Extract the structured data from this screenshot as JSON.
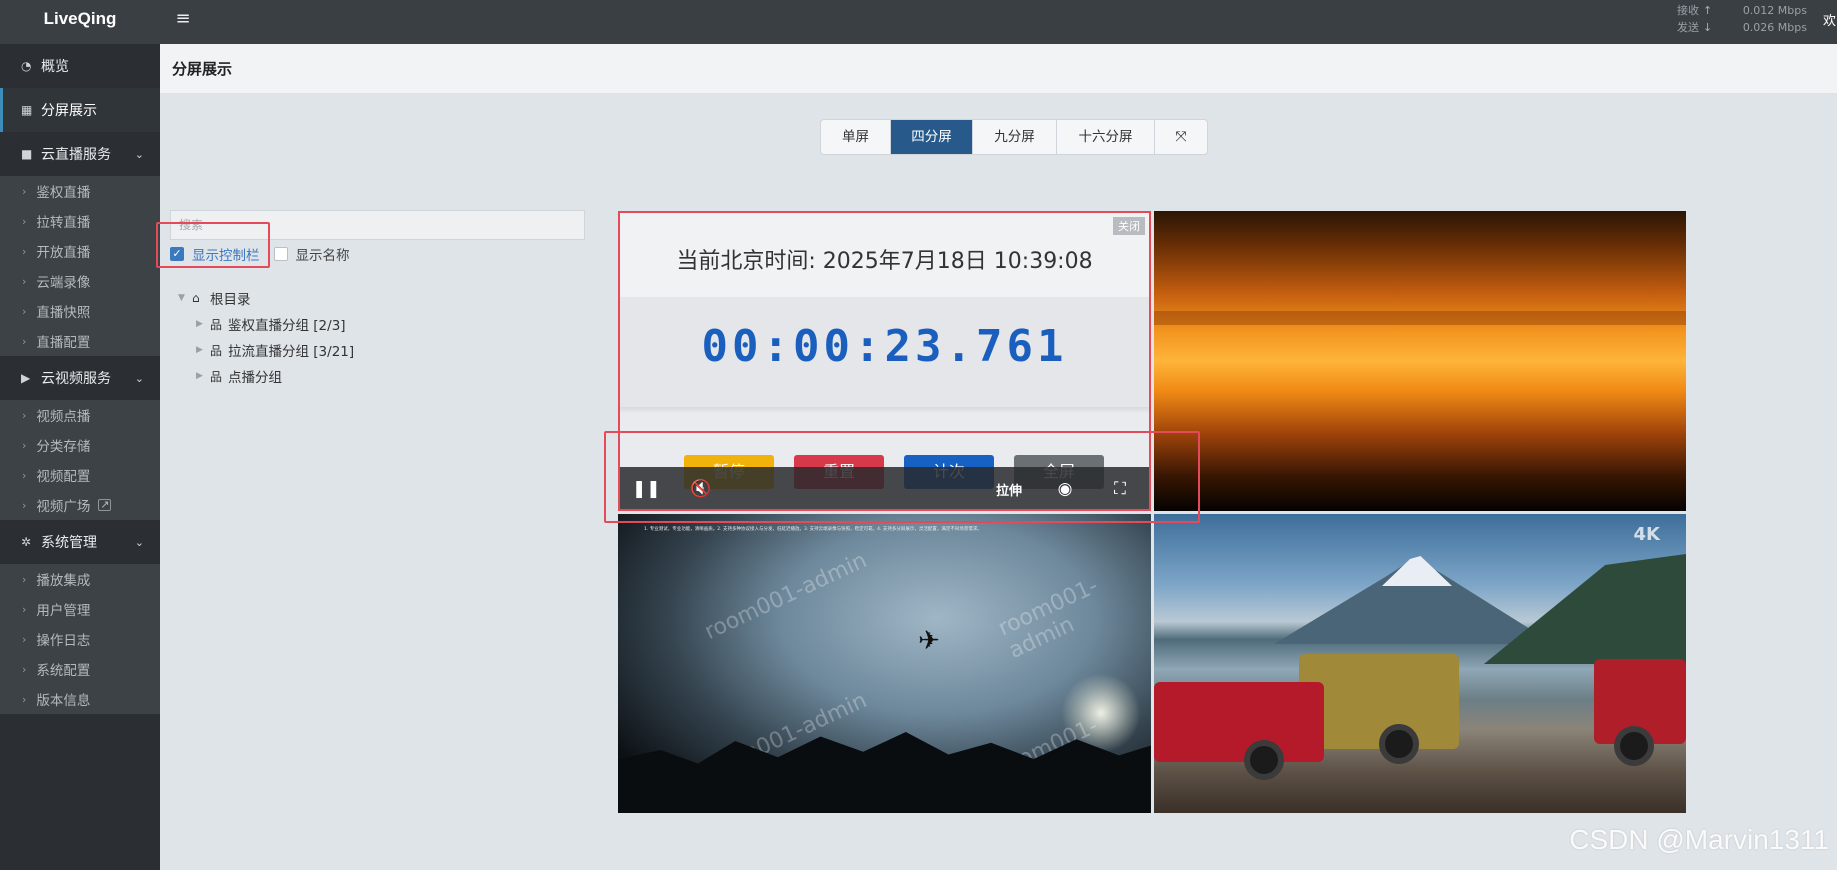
{
  "app": {
    "logo": "LiveQing"
  },
  "net": {
    "recv_label": "接收",
    "recv_value": "0.012 Mbps",
    "send_label": "发送",
    "send_value": "0.026 Mbps"
  },
  "topright_text": "欢",
  "sidebar": {
    "top_items": [
      {
        "label": "概览"
      },
      {
        "label": "分屏展示"
      }
    ],
    "groups": [
      {
        "label": "云直播服务",
        "items": [
          "鉴权直播",
          "拉转直播",
          "开放直播",
          "云端录像",
          "直播快照",
          "直播配置"
        ]
      },
      {
        "label": "云视频服务",
        "items": [
          "视频点播",
          "分类存储",
          "视频配置",
          "视频广场"
        ]
      },
      {
        "label": "系统管理",
        "items": [
          "播放集成",
          "用户管理",
          "操作日志",
          "系统配置",
          "版本信息"
        ]
      }
    ]
  },
  "header": {
    "title": "分屏展示"
  },
  "split_buttons": [
    "单屏",
    "四分屏",
    "九分屏",
    "十六分屏"
  ],
  "split_active_index": 1,
  "tree_panel": {
    "search_placeholder": "搜索",
    "show_controls_label": "显示控制栏",
    "show_controls_checked": true,
    "show_names_label": "显示名称",
    "show_names_checked": false,
    "root_label": "根目录",
    "children": [
      "鉴权直播分组 [2/3]",
      "拉流直播分组 [3/21]",
      "点播分组"
    ]
  },
  "cell1": {
    "close_label": "关闭",
    "clock_text": "当前北京时间: 2025年7月18日 10:39:08",
    "timer": "00:00:23.761",
    "buttons": [
      "暂停",
      "重置",
      "计次",
      "全屏"
    ],
    "stretch_label": "拉伸"
  },
  "cell3": {
    "watermark": "room001-admin",
    "tiny_text": "1. 专业测试，专业功能，清晰画质。2. 支持多种协议接入与分发，低延迟播放。3. 支持云端录像与快照，稳定可靠。4. 支持多分屏展示，灵活配置，满足不同场景需求。"
  },
  "cell4": {
    "badge": "4K"
  },
  "footer_watermark": "CSDN @Marvin1311",
  "colors": {
    "accent": "#27598b",
    "highlight": "#e34b5b",
    "timer": "#1a5fbd"
  }
}
